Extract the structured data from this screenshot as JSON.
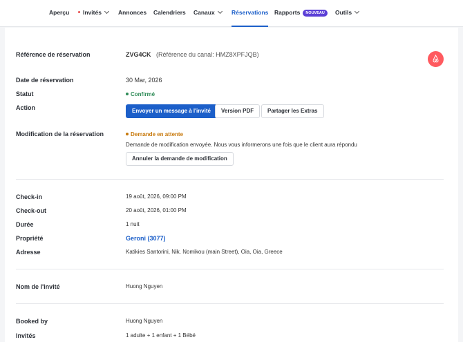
{
  "nav": {
    "items": [
      {
        "label": "Aperçu"
      },
      {
        "label": "Invités"
      },
      {
        "label": "Annonces"
      },
      {
        "label": "Calendriers"
      },
      {
        "label": "Canaux"
      },
      {
        "label": "Réservations"
      },
      {
        "label": "Rapports",
        "badge": "NOUVEAU"
      },
      {
        "label": "Outils"
      }
    ],
    "active": "Réservations"
  },
  "reservation": {
    "ref_label": "Référence de réservation",
    "ref": "ZVG4CK",
    "channel_ref": "(Référence du canal: HMZ8XPFJQB)",
    "channel_icon": "airbnb-icon",
    "date_label": "Date de réservation",
    "date": "30 Mar, 2026",
    "status_label": "Statut",
    "status": "Confirmé",
    "status_color": "#2e8b57",
    "action_label": "Action",
    "actions": {
      "message": "Envoyer un message à l'invité",
      "pdf": "Version PDF",
      "extras": "Partager les Extras"
    },
    "mod_label": "Modification de la réservation",
    "mod_status": "Demande en attente",
    "mod_color": "#c7780a",
    "mod_text": "Demande de modification envoyée. Nous vous informerons une fois que le client aura répondu",
    "mod_cancel": "Annuler la demande de modification"
  },
  "stay": {
    "checkin_label": "Check-in",
    "checkin": "19 août, 2026, 09:00 PM",
    "checkout_label": "Check-out",
    "checkout": "20 août, 2026, 01:00 PM",
    "duration_label": "Durée",
    "duration": "1 nuit",
    "property_label": "Propriété",
    "property": "Geroni (3077)",
    "address_label": "Adresse",
    "address": "Katikies Santorini, Nik. Nomikou (main Street), Oia, Oia, Greece"
  },
  "guest": {
    "name_label": "Nom de l'invité",
    "name": "Huong Nguyen"
  },
  "booking": {
    "booked_by_label": "Booked by",
    "booked_by": "Huong Nguyen",
    "guests_label": "Invités",
    "guests": "1 adulte + 1 enfant + 1 Bébé"
  }
}
